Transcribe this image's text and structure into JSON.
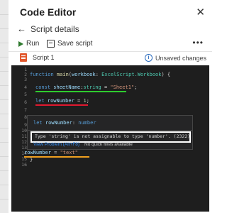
{
  "panel": {
    "title": "Code Editor",
    "back_label": "Script details"
  },
  "toolbar": {
    "run_label": "Run",
    "save_label": "Save script",
    "more_label": "•••"
  },
  "script": {
    "name": "Script 1",
    "status": "Unsaved changes"
  },
  "editor": {
    "line_numbers": [
      "1",
      "2",
      "3",
      "4",
      "5",
      "6",
      "7",
      "8",
      "9",
      "10",
      "11",
      "12",
      "13",
      "14",
      "15",
      "16"
    ],
    "hover": {
      "signature": "let rowNumber: number",
      "error": "Type 'string' is not assignable to type 'number'. (2322)",
      "view_problem": "View Problem (Alt+F8)",
      "no_quick_fix": "No quick fixes available"
    },
    "code": {
      "l2_kw": "function",
      "l2_fn": "main",
      "l2_p1": "(",
      "l2_param": "workbook",
      "l2_colon": ": ",
      "l2_type": "ExcelScript.Workbook",
      "l2_end": ") {",
      "l4_kw": "const",
      "l4_var": " sheetName",
      "l4_colon": ":",
      "l4_type": "string",
      "l4_eq": " = ",
      "l4_str": "\"Sheet1\"",
      "l4_semi": ";",
      "l6_kw": "let",
      "l6_var": " rowNumber",
      "l6_eq": " = ",
      "l6_num": "1",
      "l6_semi": ";",
      "l14_var": "rowNumber",
      "l14_eq": " = ",
      "l14_str": "\"text\"",
      "l15": "}"
    }
  },
  "colors": {
    "underline_green": "#2ecc2e",
    "underline_red": "#e0192f",
    "underline_orange": "#f0a020",
    "editor_bg": "#1e1e1e"
  },
  "icons": [
    "close-icon",
    "back-arrow-icon",
    "run-icon",
    "save-icon",
    "more-icon",
    "typescript-file-icon",
    "info-icon"
  ]
}
